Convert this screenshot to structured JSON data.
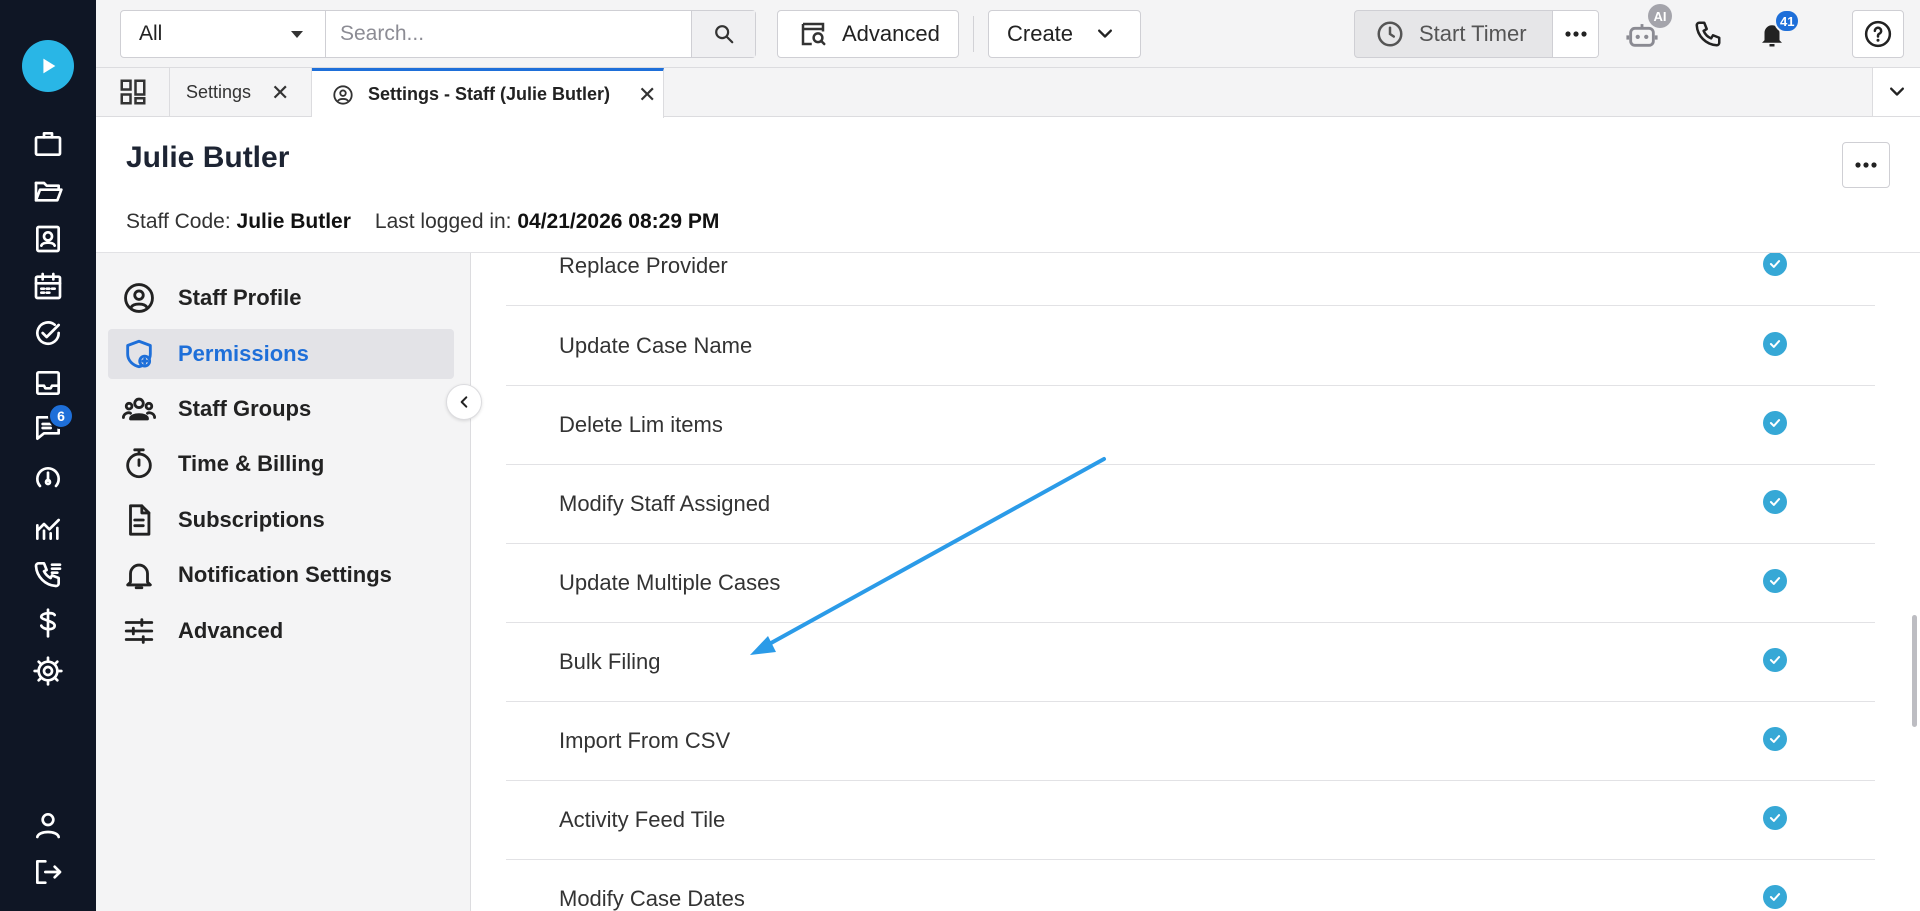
{
  "top_bar": {
    "scope_value": "All",
    "search_placeholder": "Search...",
    "advanced_label": "Advanced",
    "create_label": "Create",
    "timer_label": "Start Timer",
    "ai_badge": "AI",
    "notifications_count": "41"
  },
  "rail": {
    "messages_badge": "6"
  },
  "tabs": [
    {
      "label": "Settings"
    },
    {
      "label": "Settings - Staff (Julie Butler)"
    }
  ],
  "header": {
    "title": "Julie Butler",
    "staff_code_label": "Staff Code:",
    "staff_code_value": "Julie Butler",
    "last_login_label": "Last logged in:",
    "last_login_value": "04/21/2026 08:29 PM"
  },
  "settings_nav": [
    {
      "label": "Staff Profile",
      "icon": "user-circle-icon"
    },
    {
      "label": "Permissions",
      "icon": "shield-icon",
      "active": true
    },
    {
      "label": "Staff Groups",
      "icon": "users-icon"
    },
    {
      "label": "Time & Billing",
      "icon": "stopwatch-icon"
    },
    {
      "label": "Subscriptions",
      "icon": "document-icon"
    },
    {
      "label": "Notification Settings",
      "icon": "bell-icon"
    },
    {
      "label": "Advanced",
      "icon": "sliders-icon"
    }
  ],
  "permissions": [
    {
      "label": "Replace Provider",
      "enabled": true
    },
    {
      "label": "Update Case Name",
      "enabled": true
    },
    {
      "label": "Delete Lim items",
      "enabled": true
    },
    {
      "label": "Modify Staff Assigned",
      "enabled": true
    },
    {
      "label": "Update Multiple Cases",
      "enabled": true
    },
    {
      "label": "Bulk Filing",
      "enabled": true
    },
    {
      "label": "Import From CSV",
      "enabled": true
    },
    {
      "label": "Activity Feed Tile",
      "enabled": true
    },
    {
      "label": "Modify Case Dates",
      "enabled": true
    }
  ],
  "colors": {
    "accent": "#1e6fd9",
    "check": "#36a8d6",
    "rail_bg": "#0f1625",
    "annotation_arrow": "#2b9be8"
  }
}
